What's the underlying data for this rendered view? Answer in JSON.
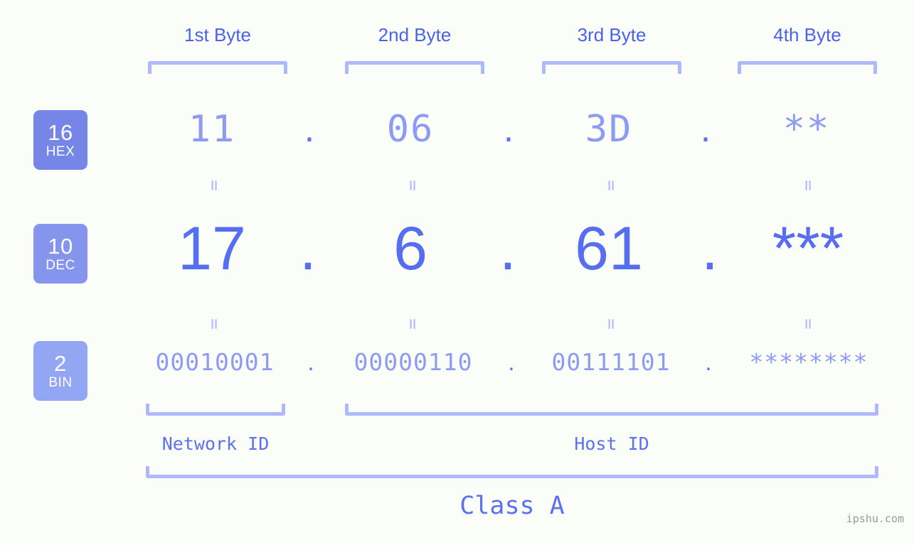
{
  "byte_headers": [
    {
      "label": "1st Byte"
    },
    {
      "label": "2nd Byte"
    },
    {
      "label": "3rd Byte"
    },
    {
      "label": "4th Byte"
    }
  ],
  "bases": [
    {
      "number": "16",
      "name": "HEX",
      "color": "#7686e6"
    },
    {
      "number": "10",
      "name": "DEC",
      "color": "#8595ee"
    },
    {
      "number": "2",
      "name": "BIN",
      "color": "#92a6f3"
    }
  ],
  "rows": {
    "hex": {
      "values": [
        "11",
        "06",
        "3D",
        "**"
      ]
    },
    "dec": {
      "values": [
        "17",
        "6",
        "61",
        "***"
      ]
    },
    "bin": {
      "values": [
        "00010001",
        "00000110",
        "00111101",
        "********"
      ]
    }
  },
  "separator": ".",
  "equality_mark": "=",
  "sections": {
    "network_id": "Network ID",
    "host_id": "Host ID",
    "class": "Class A"
  },
  "watermark": "ipshu.com",
  "colors": {
    "background": "#fbfdf8",
    "accent_strong": "#4a62ee",
    "accent_mid": "#566ef0",
    "accent_light": "#8d9cf2",
    "bracket": "#aeb9fb",
    "watermark": "#9a9a9a"
  }
}
